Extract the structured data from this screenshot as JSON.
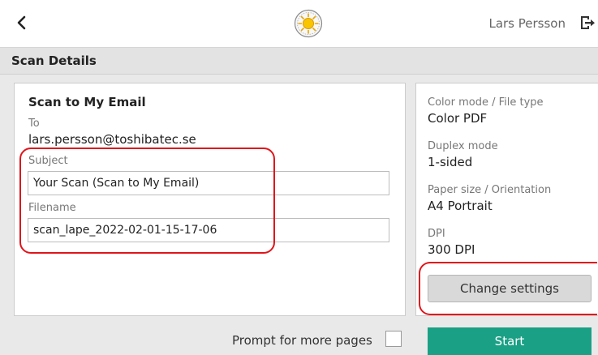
{
  "header": {
    "user_name": "Lars Persson",
    "back_icon": "chevron-left-icon",
    "logo_icon": "sun-logo-icon",
    "logout_icon": "logout-icon"
  },
  "page": {
    "title": "Scan Details"
  },
  "scan": {
    "section_title": "Scan to My Email",
    "to_label": "To",
    "to_value": "lars.persson@toshibatec.se",
    "subject_label": "Subject",
    "subject_value": "Your Scan (Scan to My Email)",
    "filename_label": "Filename",
    "filename_value": "scan_lape_2022-02-01-15-17-06"
  },
  "settings": {
    "color_label": "Color mode / File type",
    "color_value": "Color PDF",
    "duplex_label": "Duplex mode",
    "duplex_value": "1-sided",
    "paper_label": "Paper size / Orientation",
    "paper_value": "A4 Portrait",
    "dpi_label": "DPI",
    "dpi_value": "300 DPI",
    "change_button": "Change settings"
  },
  "footer": {
    "prompt_label": "Prompt for more pages",
    "prompt_checked": false,
    "start_button": "Start"
  },
  "colors": {
    "accent": "#1aa085",
    "highlight": "#e0151b"
  }
}
